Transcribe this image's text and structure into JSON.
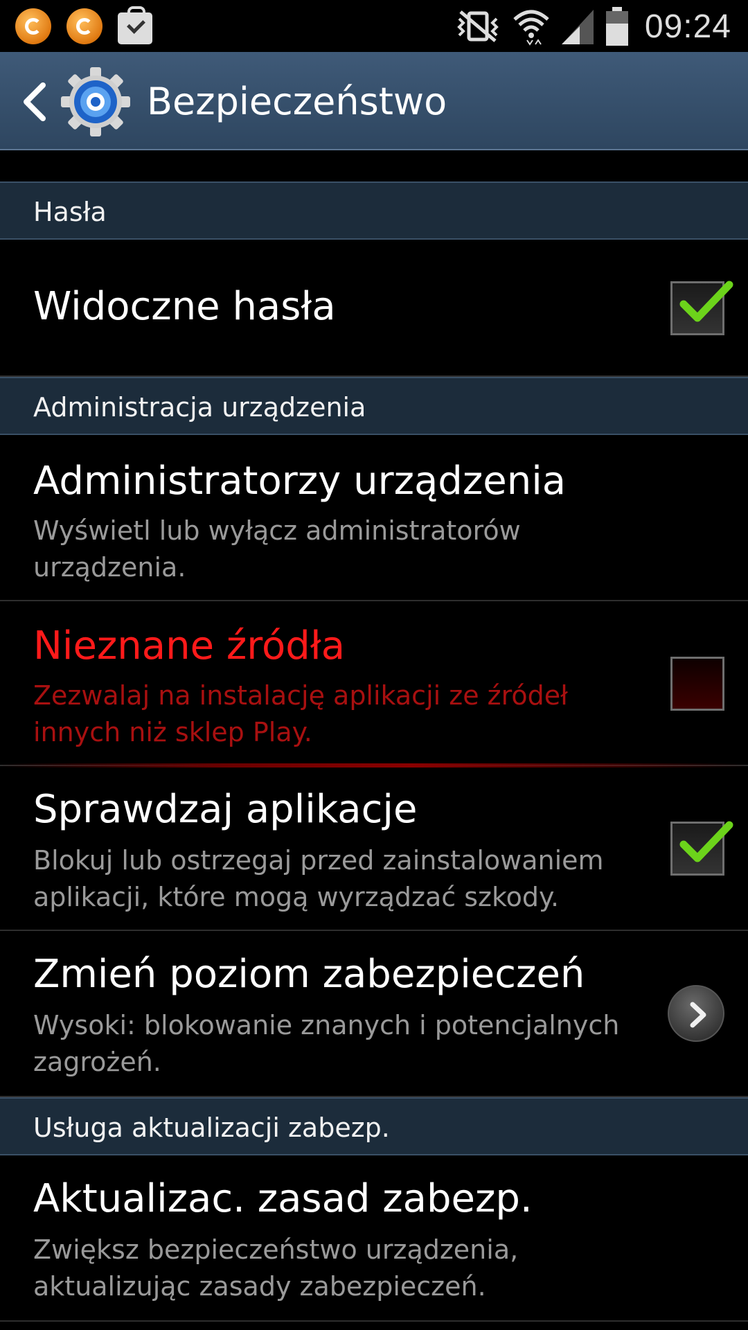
{
  "status_bar": {
    "time": "09:24",
    "icons": [
      "notification-app-icon",
      "notification-app-icon",
      "shopping-bag-check-icon",
      "mute-vibrate-icon",
      "wifi-icon",
      "signal-icon",
      "battery-icon"
    ]
  },
  "action_bar": {
    "title": "Bezpieczeństwo",
    "icon": "settings-gear-icon"
  },
  "sections": {
    "passwords": "Hasła",
    "device_admin": "Administracja urządzenia",
    "security_update": "Usługa aktualizacji zabezp."
  },
  "items": {
    "visible_passwords": {
      "title": "Widoczne hasła",
      "checked": true
    },
    "device_admins": {
      "title": "Administratorzy urządzenia",
      "subtitle": "Wyświetl lub wyłącz administratorów urządzenia."
    },
    "unknown_sources": {
      "title": "Nieznane źródła",
      "subtitle": "Zezwalaj na instalację aplikacji ze źródeł innych niż sklep Play.",
      "checked": false
    },
    "verify_apps": {
      "title": "Sprawdzaj aplikacje",
      "subtitle": "Blokuj lub ostrzegaj przed zainstalowaniem aplikacji, które mogą wyrządzać szkody.",
      "checked": true
    },
    "security_level": {
      "title": "Zmień poziom zabezpieczeń",
      "subtitle": "Wysoki: blokowanie znanych i potencjalnych zagrożeń."
    },
    "policy_update": {
      "title": "Aktualizac. zasad zabezp.",
      "subtitle": "Zwiększ bezpieczeństwo urządzenia, aktualizując zasady zabezpieczeń."
    }
  },
  "colors": {
    "action_bar": "#34506c",
    "section_bg": "#1c2c3b",
    "warning_red": "#ff1a1a",
    "check_green": "#6cd31b"
  }
}
